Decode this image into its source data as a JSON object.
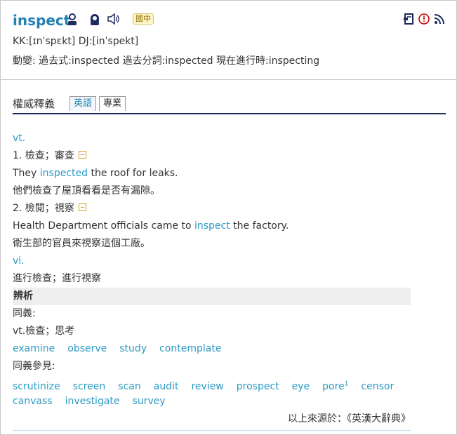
{
  "header": {
    "word": "inspect",
    "badge": "國中",
    "pronunciation": "KK:[ɪnˈspɛkt] DJ:[inˈspekt]",
    "forms": "動變: 過去式:inspected  過去分詞:inspected  現在進行時:inspecting",
    "icons": [
      "male-voice-icon",
      "female-voice-icon",
      "speaker-icon",
      "notebook-icon",
      "alert-icon",
      "rss-icon"
    ]
  },
  "tabs": {
    "label": "權威釋義",
    "items": [
      "英語",
      "專業"
    ],
    "active": "英語"
  },
  "entries": {
    "vt_label": "vt.",
    "sense1": "1. 檢查；審查",
    "ex1_pre": "They ",
    "ex1_kw": "inspected",
    "ex1_post": " the roof for leaks.",
    "ex1_tr": "他們檢查了屋頂看看是否有漏隙。",
    "sense2": "2. 檢閱；視察",
    "ex2_pre": "Health Department officials came to ",
    "ex2_kw": "inspect",
    "ex2_post": " the factory.",
    "ex2_tr": "衛生部的官員來視察這個工廠。",
    "vi_label": "vi.",
    "vi_sense": "進行檢查；進行視察",
    "section": "辨析",
    "syn_label": "同義:",
    "syn_sense": "vt.檢查；思考",
    "synonyms": [
      "examine",
      "observe",
      "study",
      "contemplate"
    ],
    "see_label": "同義參見:",
    "see_row1": [
      "scrutinize",
      "screen",
      "scan",
      "audit",
      "review",
      "prospect",
      "eye",
      "pore",
      "censor"
    ],
    "pore_sup": "1",
    "see_row2": [
      "canvass",
      "investigate",
      "survey"
    ],
    "source": "以上來源於：《英漢大辭典》"
  },
  "colors": {
    "accent": "#2580b3",
    "link": "#2c9ac4",
    "rule": "#1d2b5e"
  }
}
